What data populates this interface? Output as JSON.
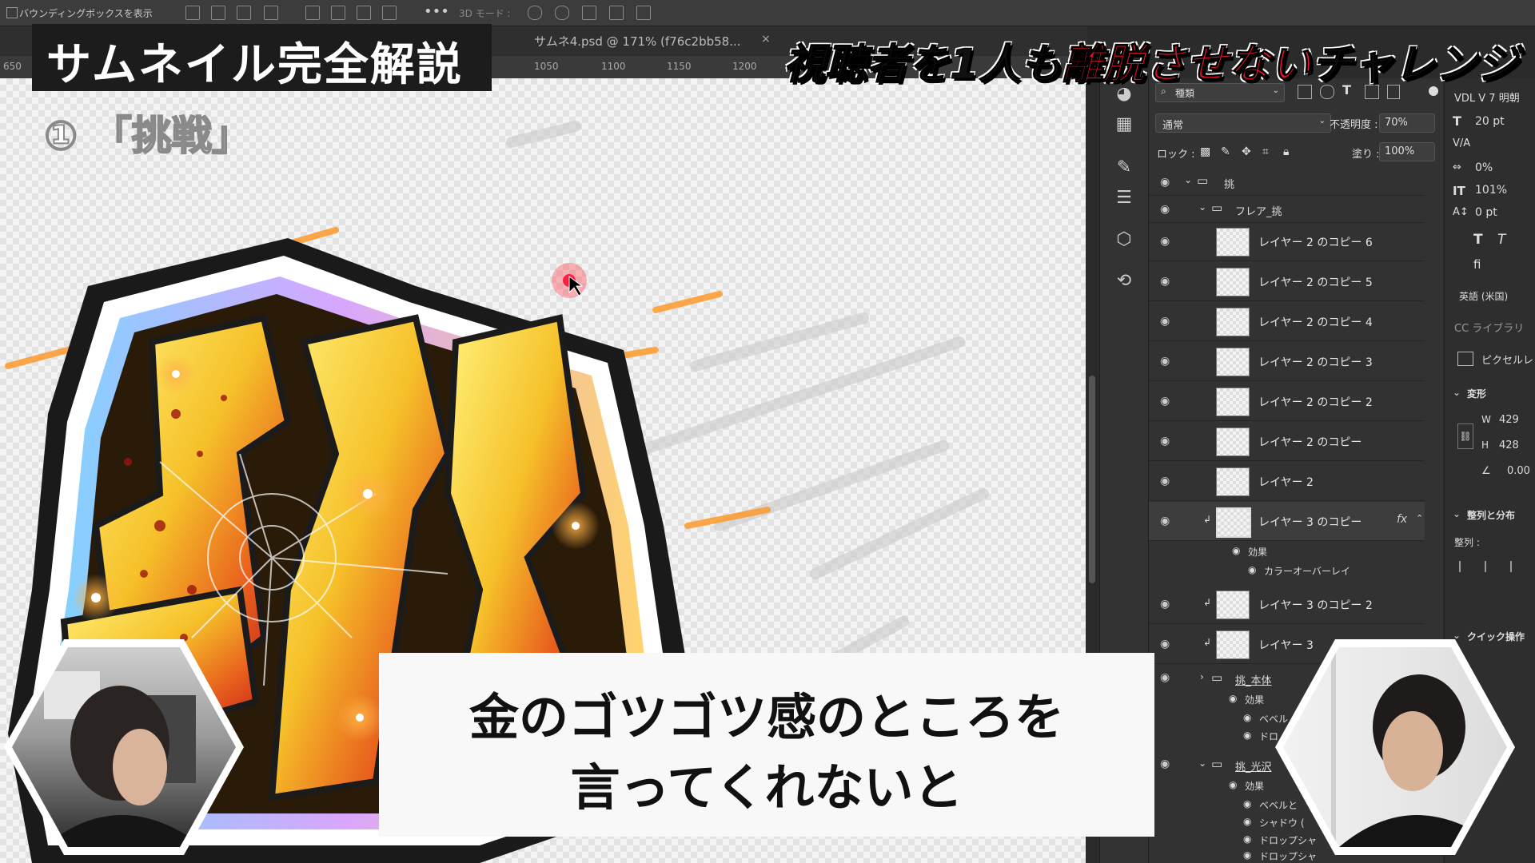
{
  "options_bar": {
    "show_bbox": "バウンディングボックスを表示",
    "mode_3d": "3D モード :"
  },
  "tabs": [
    {
      "label": "サムネ4.psd @ 171% (f76c2bb58..."
    }
  ],
  "ruler": {
    "ticks": [
      "650",
      "1050",
      "1100",
      "1150",
      "1200"
    ]
  },
  "overlay": {
    "title": "サムネイル完全解説",
    "subtitle": "① 「挑戦」",
    "challenge_part1": "視聴者を1人も",
    "challenge_part2": "離脱させない",
    "challenge_part3": "チャレンジ",
    "caption_line1": "金のゴツゴツ感のところを",
    "caption_line2": "言ってくれないと"
  },
  "layers_panel": {
    "filter_label": "種類",
    "blend_mode": "通常",
    "opacity_label": "不透明度 :",
    "opacity_value": "70%",
    "lock_label": "ロック :",
    "fill_label": "塗り :",
    "fill_value": "100%",
    "groups": [
      {
        "name": "挑"
      },
      {
        "name": "フレア_挑"
      }
    ],
    "layers": [
      {
        "name": "レイヤー 2 のコピー 6"
      },
      {
        "name": "レイヤー 2 のコピー 5"
      },
      {
        "name": "レイヤー 2 のコピー 4"
      },
      {
        "name": "レイヤー 2 のコピー 3"
      },
      {
        "name": "レイヤー 2 のコピー 2"
      },
      {
        "name": "レイヤー 2 のコピー"
      },
      {
        "name": "レイヤー 2"
      },
      {
        "name": "レイヤー 3 のコピー"
      },
      {
        "name": "レイヤー 3 のコピー 2"
      },
      {
        "name": "レイヤー 3"
      }
    ],
    "fx_label": "fx",
    "effects_label": "効果",
    "color_overlay": "カラーオーバーレイ",
    "group_hon": "挑_本体",
    "group_hikari": "挑_光沢",
    "effect_bevel": "ベベル",
    "effect_drop": "ドロ",
    "effect_bevel2": "ベベルと",
    "effect_shadow": "シャドウ (",
    "effect_dropshadow": "ドロップシャ",
    "effect_dropshadow2": "ドロップシャ"
  },
  "properties_panel": {
    "font": "VDL V 7 明朝",
    "font_size": "20 pt",
    "tracking": "0%",
    "vscale": "101%",
    "baseline": "0 pt",
    "language": "英語 (米国)",
    "cc_library": "CC ライブラリ",
    "pixel_layer": "ピクセルレ",
    "transform": "変形",
    "w_label": "W",
    "w_value": "429",
    "h_label": "H",
    "h_value": "428",
    "angle_value": "0.00",
    "align_section": "整列と分布",
    "align_label": "整列 :",
    "quick_actions": "クイック操作"
  }
}
